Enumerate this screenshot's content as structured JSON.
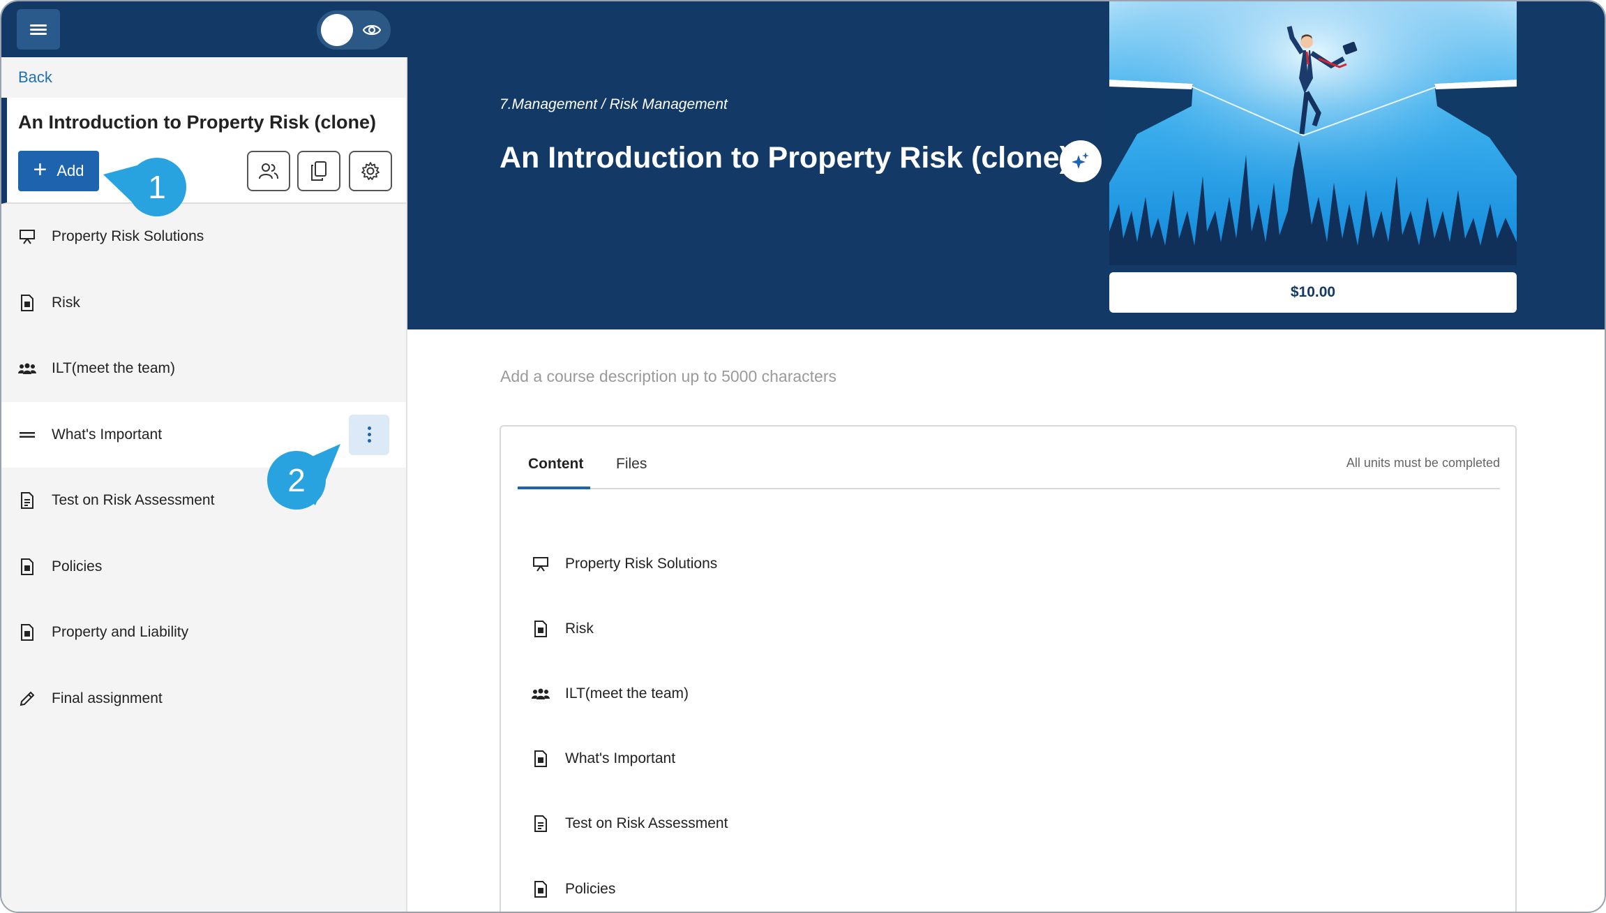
{
  "sidebar": {
    "back_label": "Back",
    "course_title": "An Introduction to Property Risk (clone)",
    "add_label": "Add",
    "items": [
      {
        "label": "Property Risk Solutions",
        "icon": "presentation-icon"
      },
      {
        "label": "Risk",
        "icon": "document-icon"
      },
      {
        "label": "ILT(meet the team)",
        "icon": "group-icon"
      },
      {
        "label": "What's Important",
        "icon": "section-icon"
      },
      {
        "label": "Test on Risk Assessment",
        "icon": "test-icon"
      },
      {
        "label": "Policies",
        "icon": "document-icon"
      },
      {
        "label": "Property and Liability",
        "icon": "document-icon"
      },
      {
        "label": "Final assignment",
        "icon": "pencil-icon"
      }
    ]
  },
  "callouts": {
    "one": "1",
    "two": "2"
  },
  "header": {
    "breadcrumb": "7.Management / Risk Management",
    "title": "An Introduction to Property Risk (clone)",
    "price": "$10.00"
  },
  "main": {
    "description_placeholder": "Add a course description up to 5000 characters",
    "tabs": [
      {
        "label": "Content"
      },
      {
        "label": "Files"
      }
    ],
    "units_note": "All units must be completed",
    "content_items": [
      {
        "label": "Property Risk Solutions",
        "icon": "presentation-icon"
      },
      {
        "label": "Risk",
        "icon": "document-icon"
      },
      {
        "label": "ILT(meet the team)",
        "icon": "group-icon"
      },
      {
        "label": "What's Important",
        "icon": "document-icon"
      },
      {
        "label": "Test on Risk Assessment",
        "icon": "test-icon"
      },
      {
        "label": "Policies",
        "icon": "document-icon"
      }
    ]
  },
  "colors": {
    "navy": "#133a66",
    "accent": "#1e63ad",
    "callout": "#28a3df"
  }
}
